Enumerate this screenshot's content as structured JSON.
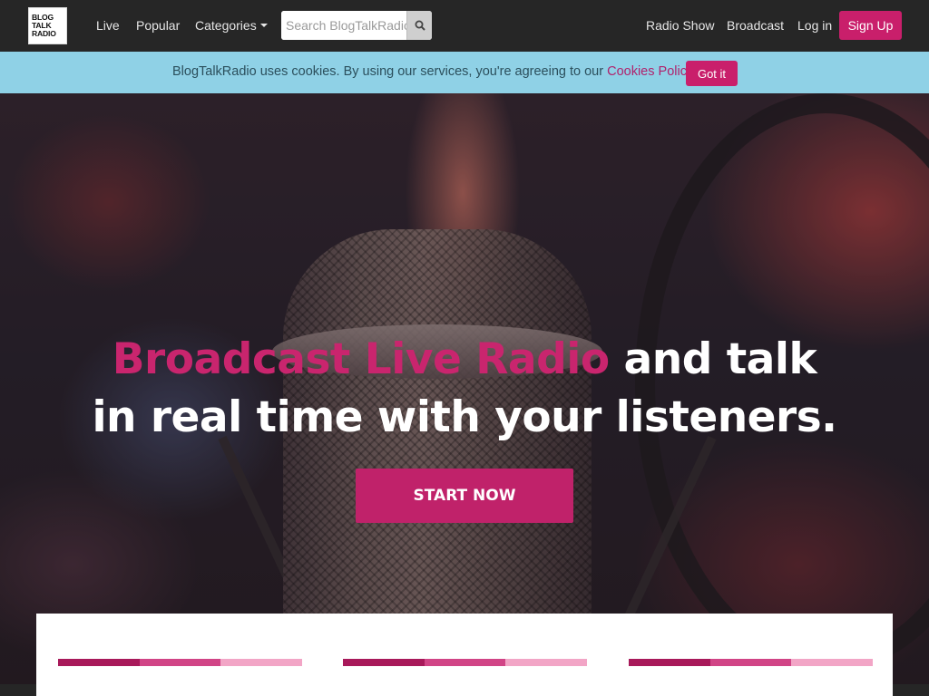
{
  "brand": {
    "logo_lines": [
      "BLOG",
      "TALK",
      "RADIO"
    ],
    "accent_color": "#c91f6b",
    "cookie_bar_color": "#8fd1e6"
  },
  "nav": {
    "left_links": [
      "Live",
      "Popular",
      "Categories"
    ],
    "search_placeholder": "Search BlogTalkRadio",
    "search_icon": "magnifier-icon",
    "right_links": [
      "Radio Show",
      "Broadcast",
      "Log in"
    ],
    "signup_label": "Sign Up"
  },
  "cookie": {
    "message": "BlogTalkRadio uses cookies. By using our services, you're agreeing to our ",
    "link_label": "Cookies Policy",
    "button_label": "Got it"
  },
  "hero": {
    "headline_accent": "Broadcast Live Radio",
    "headline_rest_1": " and talk",
    "headline_line_2": "in real time with your listeners.",
    "cta_label": "START NOW"
  }
}
